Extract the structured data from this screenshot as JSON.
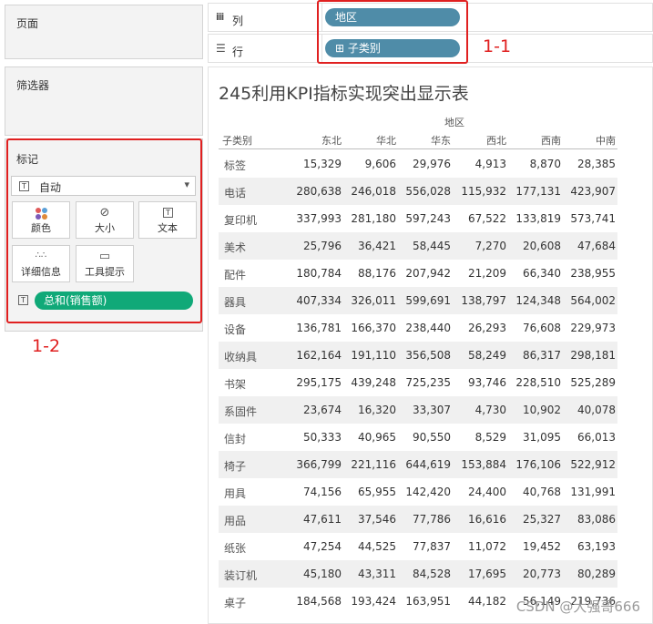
{
  "left_panels": {
    "pages_title": "页面",
    "filters_title": "筛选器",
    "marks": {
      "title": "标记",
      "mark_type": "自动",
      "buttons": [
        {
          "label": "颜色",
          "icon": "color-dots-icon"
        },
        {
          "label": "大小",
          "icon": "size-icon"
        },
        {
          "label": "文本",
          "icon": "text-icon"
        },
        {
          "label": "详细信息",
          "icon": "detail-icon"
        },
        {
          "label": "工具提示",
          "icon": "tooltip-icon"
        }
      ],
      "field_pill": "总和(销售额)"
    }
  },
  "shelves": {
    "columns": {
      "icon": "iii",
      "label": "列",
      "pill": "地区"
    },
    "rows": {
      "icon": "☰",
      "label": "行",
      "pill": "子类别",
      "pill_prefix": "⊞"
    }
  },
  "annotations": {
    "box1_label": "1-1",
    "box2_label": "1-2"
  },
  "view": {
    "title": "245利用KPI指标实现突出显示表",
    "column_group_header": "地区",
    "row_header_title": "子类别",
    "columns": [
      "东北",
      "华北",
      "华东",
      "西北",
      "西南",
      "中南"
    ],
    "rows": [
      {
        "label": "标签",
        "values": [
          "15,329",
          "9,606",
          "29,976",
          "4,913",
          "8,870",
          "28,385"
        ]
      },
      {
        "label": "电话",
        "values": [
          "280,638",
          "246,018",
          "556,028",
          "115,932",
          "177,131",
          "423,907"
        ]
      },
      {
        "label": "复印机",
        "values": [
          "337,993",
          "281,180",
          "597,243",
          "67,522",
          "133,819",
          "573,741"
        ]
      },
      {
        "label": "美术",
        "values": [
          "25,796",
          "36,421",
          "58,445",
          "7,270",
          "20,608",
          "47,684"
        ]
      },
      {
        "label": "配件",
        "values": [
          "180,784",
          "88,176",
          "207,942",
          "21,209",
          "66,340",
          "238,955"
        ]
      },
      {
        "label": "器具",
        "values": [
          "407,334",
          "326,011",
          "599,691",
          "138,797",
          "124,348",
          "564,002"
        ]
      },
      {
        "label": "设备",
        "values": [
          "136,781",
          "166,370",
          "238,440",
          "26,293",
          "76,608",
          "229,973"
        ]
      },
      {
        "label": "收纳具",
        "values": [
          "162,164",
          "191,110",
          "356,508",
          "58,249",
          "86,317",
          "298,181"
        ]
      },
      {
        "label": "书架",
        "values": [
          "295,175",
          "439,248",
          "725,235",
          "93,746",
          "228,510",
          "525,289"
        ]
      },
      {
        "label": "系固件",
        "values": [
          "23,674",
          "16,320",
          "33,307",
          "4,730",
          "10,902",
          "40,078"
        ]
      },
      {
        "label": "信封",
        "values": [
          "50,333",
          "40,965",
          "90,550",
          "8,529",
          "31,095",
          "66,013"
        ]
      },
      {
        "label": "椅子",
        "values": [
          "366,799",
          "221,116",
          "644,619",
          "153,884",
          "176,106",
          "522,912"
        ]
      },
      {
        "label": "用具",
        "values": [
          "74,156",
          "65,955",
          "142,420",
          "24,400",
          "40,768",
          "131,991"
        ]
      },
      {
        "label": "用品",
        "values": [
          "47,611",
          "37,546",
          "77,786",
          "16,616",
          "25,327",
          "83,086"
        ]
      },
      {
        "label": "纸张",
        "values": [
          "47,254",
          "44,525",
          "77,837",
          "11,072",
          "19,452",
          "63,193"
        ]
      },
      {
        "label": "装订机",
        "values": [
          "45,180",
          "43,311",
          "84,528",
          "17,695",
          "20,773",
          "80,289"
        ]
      },
      {
        "label": "桌子",
        "values": [
          "184,568",
          "193,424",
          "163,951",
          "44,182",
          "56,149",
          "219,736"
        ]
      }
    ]
  },
  "watermark": "CSDN @大强哥666",
  "colors": {
    "dimension_pill": "#4f8ca8",
    "measure_pill": "#10a978",
    "annotation_red": "#e02020",
    "band_gray": "#f0f0f0"
  }
}
